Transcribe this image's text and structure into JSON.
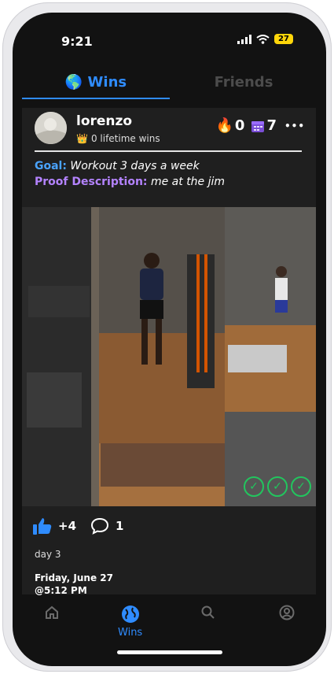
{
  "status": {
    "time": "9:21",
    "battery": "27"
  },
  "tabs": [
    {
      "label": "🌎 Wins",
      "active": true
    },
    {
      "label": "Friends",
      "active": false
    }
  ],
  "post": {
    "username": "lorenzo",
    "lifetime_icon": "👑",
    "lifetime_text": "0 lifetime wins",
    "fire_icon": "🔥",
    "fire_count": "0",
    "calendar_count": "7",
    "more_label": "•••",
    "goal_label": "Goal:",
    "goal_text": "Workout 3 days a week",
    "proof_label": "Proof Description:",
    "proof_text": "me at the jim",
    "checks": [
      "✓",
      "✓",
      "✓"
    ],
    "likes": "+4",
    "comments": "1",
    "caption": "day 3",
    "date": "Friday, June 27",
    "time": "@5:12 PM"
  },
  "bottom_nav": {
    "items": [
      {
        "icon": "home-icon",
        "label": ""
      },
      {
        "icon": "globe-icon",
        "label": "Wins"
      },
      {
        "icon": "search-icon",
        "label": ""
      },
      {
        "icon": "profile-icon",
        "label": ""
      }
    ]
  },
  "colors": {
    "accent": "#2f8cff",
    "goal": "#4aa3ff",
    "proof": "#b483ff",
    "check": "#22c55e"
  }
}
